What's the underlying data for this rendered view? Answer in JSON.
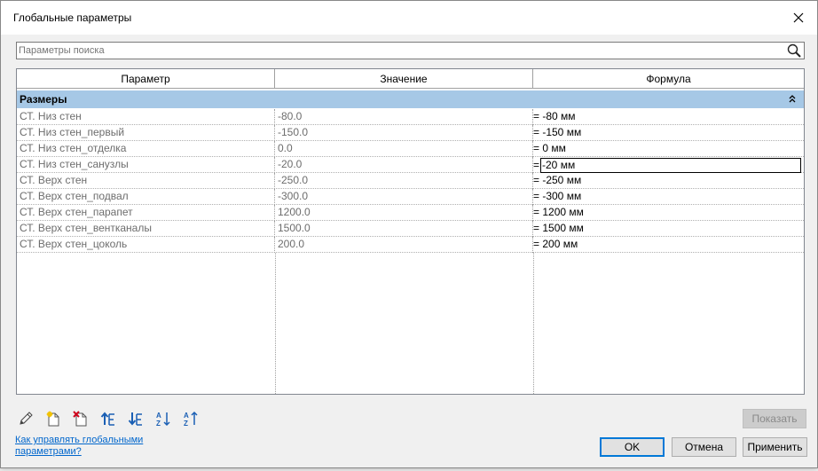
{
  "dialog": {
    "title": "Глобальные параметры"
  },
  "search": {
    "placeholder": "Параметры поиска"
  },
  "grid": {
    "columns": [
      "Параметр",
      "Значение",
      "Формула"
    ],
    "group": {
      "label": "Размеры"
    },
    "rows": [
      {
        "name": "СТ. Низ стен",
        "value": "-80.0",
        "formula": "= -80 мм"
      },
      {
        "name": "СТ. Низ стен_первый",
        "value": "-150.0",
        "formula": "= -150 мм"
      },
      {
        "name": "СТ. Низ стен_отделка",
        "value": "0.0",
        "formula": "= 0 мм"
      },
      {
        "name": "СТ. Низ стен_санузлы",
        "value": "-20.0",
        "formula": "-20 мм",
        "formula_prefix": "=",
        "active": true
      },
      {
        "name": "СТ. Верх стен",
        "value": "-250.0",
        "formula": "= -250 мм"
      },
      {
        "name": "СТ. Верх стен_подвал",
        "value": "-300.0",
        "formula": "= -300 мм"
      },
      {
        "name": "СТ. Верх стен_парапет",
        "value": "1200.0",
        "formula": "= 1200 мм"
      },
      {
        "name": "СТ. Верх стен_вентканалы",
        "value": "1500.0",
        "formula": "= 1500 мм"
      },
      {
        "name": "СТ. Верх стен_цоколь",
        "value": "200.0",
        "formula": "= 200 мм"
      }
    ]
  },
  "toolbar": {
    "icons": [
      "edit-icon",
      "new-parameter-icon",
      "delete-parameter-icon",
      "move-up-icon",
      "move-down-icon",
      "sort-ascending-icon",
      "sort-descending-icon"
    ]
  },
  "buttons": {
    "show": "Показать",
    "ok": "OK",
    "cancel": "Отмена",
    "apply": "Применить"
  },
  "help_link": "Как управлять глобальными параметрами?",
  "colors": {
    "group_header": "#a6c8e6",
    "accent": "#0078d7",
    "link": "#0066cc"
  }
}
